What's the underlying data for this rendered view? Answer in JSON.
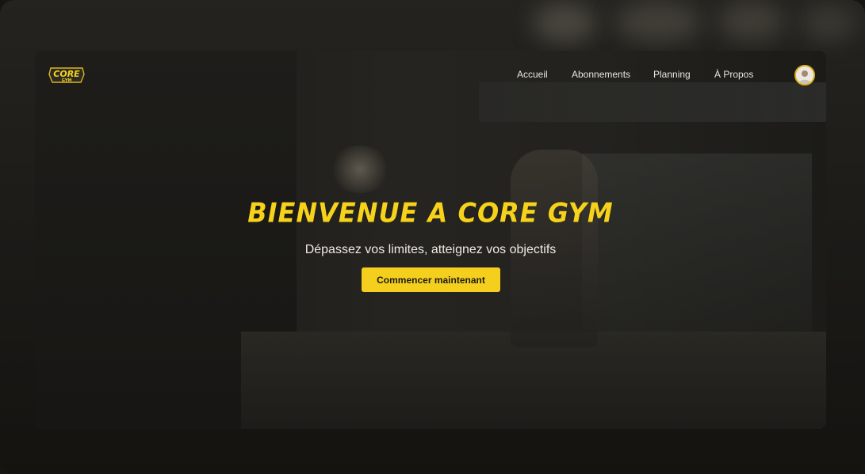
{
  "brand": {
    "logo_word": "CORE",
    "logo_sub": "GYM",
    "accent": "#f5cf1d"
  },
  "nav": {
    "items": [
      {
        "label": "Accueil"
      },
      {
        "label": "Abonnements"
      },
      {
        "label": "Planning"
      },
      {
        "label": "À Propos"
      }
    ],
    "avatar_icon": "user-avatar"
  },
  "hero": {
    "title": "BIENVENUE A CORE GYM",
    "subtitle": "Dépassez vos limites, atteignez vos objectifs",
    "cta_label": "Commencer maintenant"
  },
  "colors": {
    "title": "#f6d21b",
    "button": "#f5cf1d",
    "background": "#1d1c19"
  }
}
